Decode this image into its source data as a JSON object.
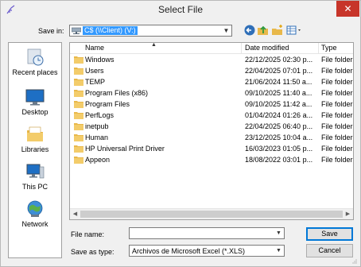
{
  "window": {
    "title": "Select File",
    "close_glyph": "✕"
  },
  "save_in": {
    "label": "Save in:",
    "value": "C$ (\\\\Client) (V:)"
  },
  "toolbar": {
    "icons": [
      "back-icon",
      "up-folder-icon",
      "new-folder-icon",
      "view-menu-icon"
    ]
  },
  "places": [
    {
      "label": "Recent places",
      "icon": "recent-places-icon"
    },
    {
      "label": "Desktop",
      "icon": "desktop-icon"
    },
    {
      "label": "Libraries",
      "icon": "libraries-icon"
    },
    {
      "label": "This PC",
      "icon": "this-pc-icon"
    },
    {
      "label": "Network",
      "icon": "network-icon"
    }
  ],
  "columns": {
    "name": "Name",
    "date": "Date modified",
    "type": "Type"
  },
  "files": [
    {
      "name": "Windows",
      "date": "22/12/2025 02:30 p...",
      "type": "File folder"
    },
    {
      "name": "Users",
      "date": "22/04/2025 07:01 p...",
      "type": "File folder"
    },
    {
      "name": "TEMP",
      "date": "21/06/2024 11:50 a...",
      "type": "File folder"
    },
    {
      "name": "Program Files (x86)",
      "date": "09/10/2025 11:40 a...",
      "type": "File folder"
    },
    {
      "name": "Program Files",
      "date": "09/10/2025 11:42 a...",
      "type": "File folder"
    },
    {
      "name": "PerfLogs",
      "date": "01/04/2024 01:26 a...",
      "type": "File folder"
    },
    {
      "name": "inetpub",
      "date": "22/04/2025 06:40 p...",
      "type": "File folder"
    },
    {
      "name": "Human",
      "date": "23/12/2025 10:04 a...",
      "type": "File folder"
    },
    {
      "name": "HP Universal Print Driver",
      "date": "16/03/2023 01:05 p...",
      "type": "File folder"
    },
    {
      "name": "Appeon",
      "date": "18/08/2022 03:01 p...",
      "type": "File folder"
    }
  ],
  "file_name": {
    "label": "File name:",
    "value": ""
  },
  "save_as_type": {
    "label": "Save as type:",
    "value": "Archivos de Microsoft Excel (*.XLS)"
  },
  "buttons": {
    "save": "Save",
    "cancel": "Cancel"
  },
  "colors": {
    "selection": "#3399ff",
    "close": "#c7352a",
    "folder": "#e8b84a"
  }
}
